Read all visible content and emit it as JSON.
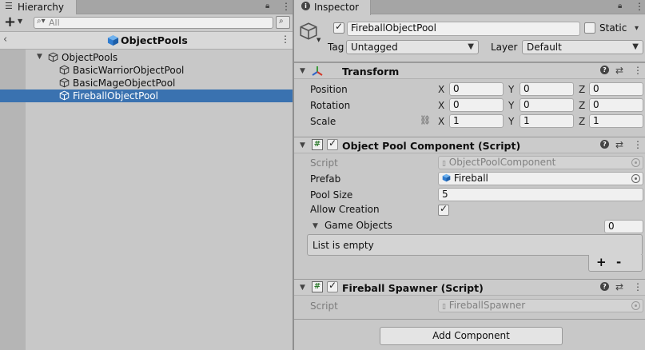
{
  "hierarchy": {
    "tab_title": "Hierarchy",
    "add_button": "+",
    "search_placeholder": "All",
    "scene_title": "ObjectPools",
    "tree": [
      {
        "label": "ObjectPools",
        "expanded": true
      },
      {
        "label": "BasicWarriorObjectPool"
      },
      {
        "label": "BasicMageObjectPool"
      },
      {
        "label": "FireballObjectPool",
        "selected": true
      }
    ]
  },
  "inspector": {
    "tab_title": "Inspector",
    "object": {
      "enabled": true,
      "name": "FireballObjectPool",
      "static_label": "Static",
      "tag_label": "Tag",
      "tag_value": "Untagged",
      "layer_label": "Layer",
      "layer_value": "Default"
    },
    "transform": {
      "title": "Transform",
      "rows": [
        {
          "label": "Position",
          "x": "0",
          "y": "0",
          "z": "0"
        },
        {
          "label": "Rotation",
          "x": "0",
          "y": "0",
          "z": "0"
        },
        {
          "label": "Scale",
          "x": "1",
          "y": "1",
          "z": "1"
        }
      ],
      "axis_x": "X",
      "axis_y": "Y",
      "axis_z": "Z"
    },
    "pool_component": {
      "title": "Object Pool Component (Script)",
      "enabled": true,
      "script_label": "Script",
      "script_value": "ObjectPoolComponent",
      "prefab_label": "Prefab",
      "prefab_value": "Fireball",
      "pool_size_label": "Pool Size",
      "pool_size_value": "5",
      "allow_creation_label": "Allow Creation",
      "allow_creation": true,
      "game_objects_label": "Game Objects",
      "game_objects_count": "0",
      "list_empty": "List is empty",
      "add_label": "+",
      "remove_label": "-"
    },
    "spawner": {
      "title": "Fireball Spawner (Script)",
      "enabled": true,
      "script_label": "Script",
      "script_value": "FireballSpawner"
    },
    "add_component": "Add Component"
  }
}
